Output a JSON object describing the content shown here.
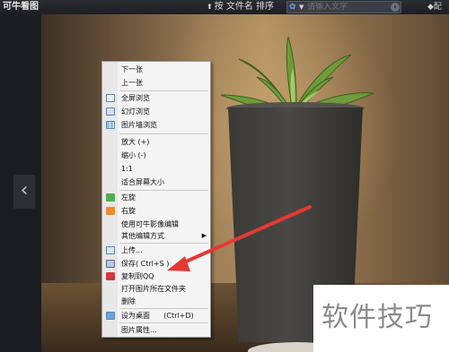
{
  "titlebar": {
    "app_title": "可牛看图",
    "sort_label": "按 文件名 排序",
    "search_placeholder": "请输入文字",
    "settings_label": "◆配"
  },
  "nav": {
    "prev_glyph": "‹"
  },
  "context_menu": {
    "items": [
      {
        "label": "下一张",
        "icon": null
      },
      {
        "label": "上一张",
        "icon": null
      },
      {
        "label": "全屏浏览",
        "icon": "fullscreen-icon"
      },
      {
        "label": "幻灯浏览",
        "icon": "slideshow-icon"
      },
      {
        "label": "图片墙浏览",
        "icon": "picture-wall-icon"
      },
      {
        "label": "放大 (+)",
        "icon": null
      },
      {
        "label": "缩小 (-)",
        "icon": null
      },
      {
        "label": "1:1",
        "icon": null
      },
      {
        "label": "适合屏幕大小",
        "icon": null
      },
      {
        "label": "左旋",
        "icon": "rotate-left-icon"
      },
      {
        "label": "右旋",
        "icon": "rotate-right-icon"
      },
      {
        "label": "使用可牛影像编辑",
        "icon": null
      },
      {
        "label": "其他编辑方式",
        "icon": null,
        "submenu": true
      },
      {
        "label": "上传...",
        "icon": "upload-icon"
      },
      {
        "label": "保存( Ctrl+S )",
        "icon": "save-icon"
      },
      {
        "label": "复制到QQ",
        "icon": "qq-icon"
      },
      {
        "label": "打开图片所在文件夹",
        "icon": null
      },
      {
        "label": "删除",
        "icon": null
      },
      {
        "label": "设为桌面      (Ctrl+D)",
        "icon": "desktop-icon"
      },
      {
        "label": "图片属性...",
        "icon": null
      }
    ],
    "submenu_glyph": "▶"
  },
  "watermark": {
    "text": "软件技巧"
  },
  "colors": {
    "annotation_arrow": "#e53935"
  }
}
